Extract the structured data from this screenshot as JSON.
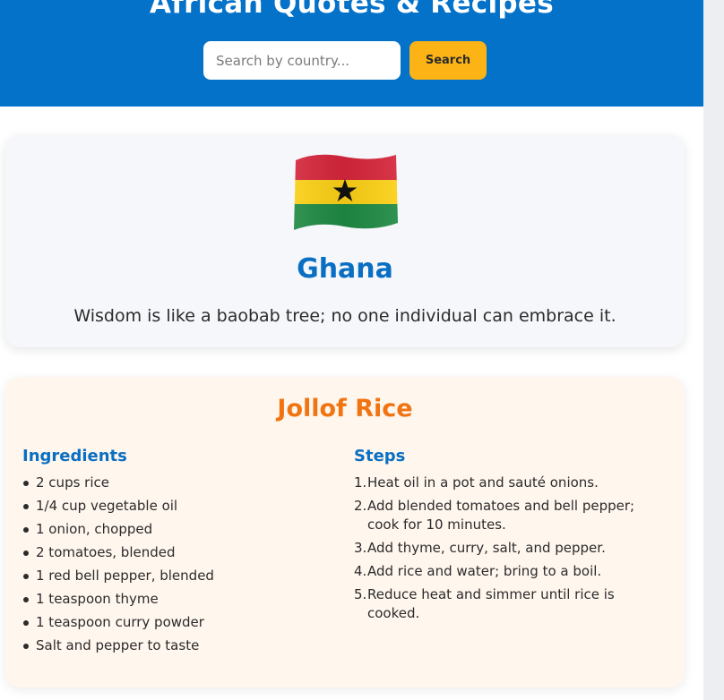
{
  "header": {
    "title": "African Quotes & Recipes",
    "search_placeholder": "Search by country...",
    "search_button": "Search",
    "background_color": "#0572c9",
    "button_color": "#fbb316"
  },
  "country": {
    "flag_icon": "ghana-flag-icon",
    "name": "Ghana",
    "quote": "Wisdom is like a baobab tree; no one individual can embrace it."
  },
  "recipe": {
    "title": "Jollof Rice",
    "ingredients_heading": "Ingredients",
    "steps_heading": "Steps",
    "ingredients": [
      "2 cups rice",
      "1/4 cup vegetable oil",
      "1 onion, chopped",
      "2 tomatoes, blended",
      "1 red bell pepper, blended",
      "1 teaspoon thyme",
      "1 teaspoon curry powder",
      "Salt and pepper to taste"
    ],
    "steps": [
      {
        "num": "1.",
        "text": "Heat oil in a pot and sauté onions."
      },
      {
        "num": "2.",
        "text": "Add blended tomatoes and bell pepper; cook for 10 minutes."
      },
      {
        "num": "3.",
        "text": "Add thyme, curry, salt, and pepper."
      },
      {
        "num": "4.",
        "text": "Add rice and water; bring to a boil."
      },
      {
        "num": "5.",
        "text": "Reduce heat and simmer until rice is cooked."
      }
    ],
    "title_color": "#f07412",
    "heading_color": "#0a6fc2"
  }
}
